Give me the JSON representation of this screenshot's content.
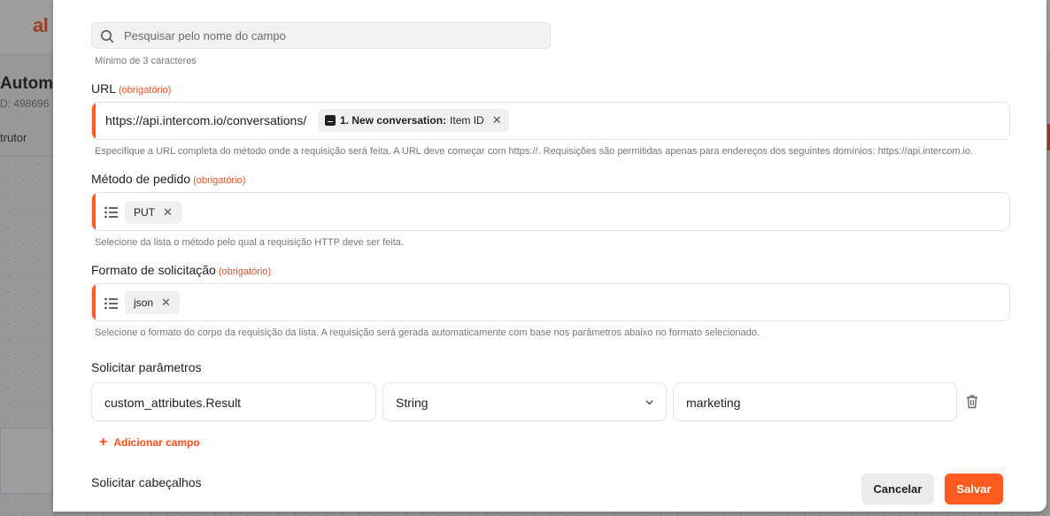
{
  "background": {
    "logo": "al",
    "title": "Automa",
    "id_text": "D: 498696",
    "tab": "trutor"
  },
  "search": {
    "placeholder": "Pesquisar pelo nome do campo",
    "hint": "Mínimo de 3 caracteres"
  },
  "url": {
    "label": "URL",
    "required": "(obrigatório)",
    "value": "https://api.intercom.io/conversations/",
    "chip_bold": "1. New conversation:",
    "chip_text": "Item ID",
    "hint": "Especifique a URL completa do método onde a requisição será feita. A URL deve começar com https://. Requisições são permitidas apenas para endereços dos seguintes domínios: https://api.intercom.io."
  },
  "method": {
    "label": "Método de pedido",
    "required": "(obrigatório)",
    "value": "PUT",
    "hint": "Selecione da lista o método pelo qual a requisição HTTP deve ser feita."
  },
  "format": {
    "label": "Formato de solicitação",
    "required": "(obrigatório)",
    "value": "json",
    "hint": "Selecione o formato do corpo da requisição da lista. A requisição será gerada automaticamente com base nos parâmetros abaixo no formato selecionado."
  },
  "params": {
    "label": "Solicitar parâmetros",
    "rows": [
      {
        "key": "custom_attributes.Result",
        "type": "String",
        "value": "marketing"
      }
    ],
    "add_label": "Adicionar campo"
  },
  "headers": {
    "label": "Solicitar cabeçalhos"
  },
  "footer": {
    "cancel_label": "Cancelar",
    "save_label": "Salvar"
  },
  "colors": {
    "accent": "#ff5a1f",
    "required": "#e4512b"
  }
}
